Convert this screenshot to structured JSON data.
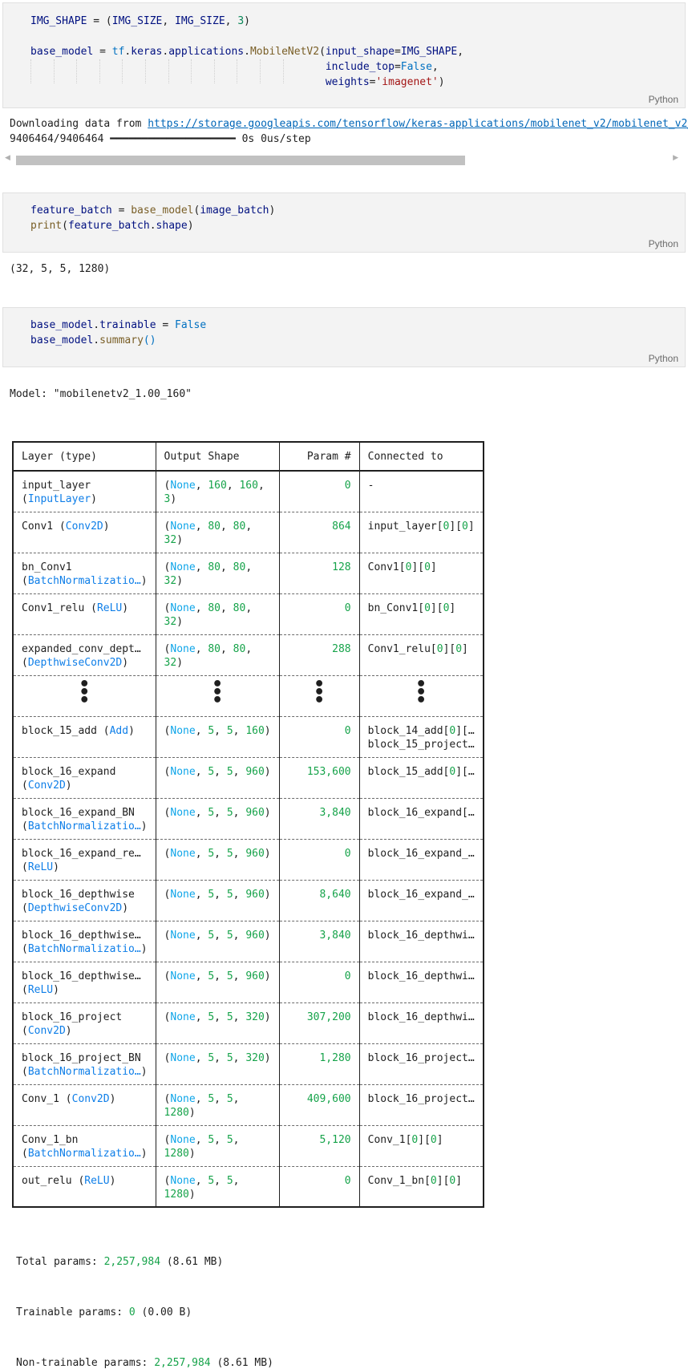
{
  "cells": [
    {
      "language": "Python",
      "lines": [
        "IMG_SHAPE = (IMG_SIZE, IMG_SIZE, 3)",
        "",
        "base_model = tf.keras.applications.MobileNetV2(input_shape=IMG_SHAPE,",
        "                                               include_top=False,",
        "                                               weights='imagenet')"
      ]
    },
    {
      "language": "Python",
      "lines": [
        "feature_batch = base_model(image_batch)",
        "print(feature_batch.shape)"
      ]
    },
    {
      "language": "Python",
      "lines": [
        "base_model.trainable = False",
        "base_model.summary()"
      ]
    }
  ],
  "outputs": {
    "download_prefix": "Downloading data from ",
    "download_url": "https://storage.googleapis.com/tensorflow/keras-applications/mobilenet_v2/mobilenet_v2_w",
    "progress_count": "9406464/9406464",
    "progress_bar": "━━━━━━━━━━━━━━━━━━━━",
    "progress_time": "0s",
    "progress_rate": "0us/step",
    "feature_shape": "(32, 5, 5, 1280)",
    "model_title": "Model: \"mobilenetv2_1.00_160\""
  },
  "summary": {
    "headers": [
      "Layer (type)",
      "Output Shape",
      "Param #",
      "Connected to"
    ],
    "rows": [
      {
        "name": "input_layer",
        "type": "InputLayer",
        "shape": [
          "None",
          "160",
          "160",
          "3"
        ],
        "shape_wrap": 3,
        "params": "0",
        "connected": "-"
      },
      {
        "name": "Conv1",
        "type": "Conv2D",
        "inline": true,
        "shape": [
          "None",
          "80",
          "80",
          "32"
        ],
        "shape_wrap": 3,
        "params": "864",
        "connected": "input_layer[0][0]"
      },
      {
        "name": "bn_Conv1",
        "type": "BatchNormalizatio…",
        "shape": [
          "None",
          "80",
          "80",
          "32"
        ],
        "shape_wrap": 3,
        "params": "128",
        "connected": "Conv1[0][0]"
      },
      {
        "name": "Conv1_relu",
        "type": "ReLU",
        "inline": true,
        "shape": [
          "None",
          "80",
          "80",
          "32"
        ],
        "shape_wrap": 3,
        "params": "0",
        "connected": "bn_Conv1[0][0]"
      },
      {
        "name": "expanded_conv_dept…",
        "type": "DepthwiseConv2D",
        "shape": [
          "None",
          "80",
          "80",
          "32"
        ],
        "shape_wrap": 3,
        "params": "288",
        "connected": "Conv1_relu[0][0]"
      },
      {
        "ellipsis": true
      },
      {
        "name": "block_15_add",
        "type": "Add",
        "inline": true,
        "shape": [
          "None",
          "5",
          "5",
          "160"
        ],
        "params": "0",
        "connected": "block_14_add[0][…",
        "connected2": "block_15_project…"
      },
      {
        "name": "block_16_expand",
        "type": "Conv2D",
        "shape": [
          "None",
          "5",
          "5",
          "960"
        ],
        "params": "153,600",
        "connected": "block_15_add[0][…"
      },
      {
        "name": "block_16_expand_BN",
        "type": "BatchNormalizatio…",
        "shape": [
          "None",
          "5",
          "5",
          "960"
        ],
        "params": "3,840",
        "connected": "block_16_expand[…"
      },
      {
        "name": "block_16_expand_re…",
        "type": "ReLU",
        "shape": [
          "None",
          "5",
          "5",
          "960"
        ],
        "params": "0",
        "connected": "block_16_expand_…"
      },
      {
        "name": "block_16_depthwise",
        "type": "DepthwiseConv2D",
        "shape": [
          "None",
          "5",
          "5",
          "960"
        ],
        "params": "8,640",
        "connected": "block_16_expand_…"
      },
      {
        "name": "block_16_depthwise…",
        "type": "BatchNormalizatio…",
        "shape": [
          "None",
          "5",
          "5",
          "960"
        ],
        "params": "3,840",
        "connected": "block_16_depthwi…"
      },
      {
        "name": "block_16_depthwise…",
        "type": "ReLU",
        "shape": [
          "None",
          "5",
          "5",
          "960"
        ],
        "params": "0",
        "connected": "block_16_depthwi…"
      },
      {
        "name": "block_16_project",
        "type": "Conv2D",
        "shape": [
          "None",
          "5",
          "5",
          "320"
        ],
        "params": "307,200",
        "connected": "block_16_depthwi…"
      },
      {
        "name": "block_16_project_BN",
        "type": "BatchNormalizatio…",
        "shape": [
          "None",
          "5",
          "5",
          "320"
        ],
        "params": "1,280",
        "connected": "block_16_project…"
      },
      {
        "name": "Conv_1",
        "type": "Conv2D",
        "inline": true,
        "shape": [
          "None",
          "5",
          "5",
          "1280"
        ],
        "shape_wrap": 3,
        "params": "409,600",
        "connected": "block_16_project…"
      },
      {
        "name": "Conv_1_bn",
        "type": "BatchNormalizatio…",
        "shape": [
          "None",
          "5",
          "5",
          "1280"
        ],
        "shape_wrap": 3,
        "params": "5,120",
        "connected": "Conv_1[0][0]"
      },
      {
        "name": "out_relu",
        "type": "ReLU",
        "inline": true,
        "shape": [
          "None",
          "5",
          "5",
          "1280"
        ],
        "shape_wrap": 3,
        "params": "0",
        "connected": "Conv_1_bn[0][0]"
      }
    ]
  },
  "totals": {
    "total_label": "Total params: ",
    "total_value": "2,257,984",
    "total_size": " (8.61 MB)",
    "trainable_label": "Trainable params: ",
    "trainable_value": "0",
    "trainable_size": " (0.00 B)",
    "nontrainable_label": "Non-trainable params: ",
    "nontrainable_value": "2,257,984",
    "nontrainable_size": " (8.61 MB)"
  }
}
